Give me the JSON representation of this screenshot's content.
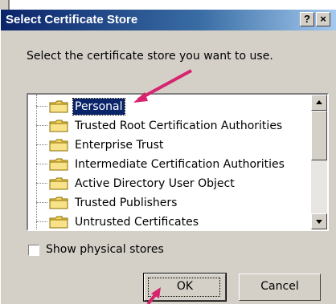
{
  "dialog": {
    "title": "Select Certificate Store",
    "help_glyph": "?",
    "close_glyph": "×",
    "prompt": "Select the certificate store you want to use."
  },
  "tree": {
    "items": [
      {
        "label": "Personal",
        "selected": true
      },
      {
        "label": "Trusted Root Certification Authorities",
        "selected": false
      },
      {
        "label": "Enterprise Trust",
        "selected": false
      },
      {
        "label": "Intermediate Certification Authorities",
        "selected": false
      },
      {
        "label": "Active Directory User Object",
        "selected": false
      },
      {
        "label": "Trusted Publishers",
        "selected": false
      },
      {
        "label": "Untrusted Certificates",
        "selected": false
      }
    ]
  },
  "options": {
    "show_physical_label": "Show physical stores",
    "show_physical_checked": false
  },
  "buttons": {
    "ok": "OK",
    "cancel": "Cancel"
  },
  "colors": {
    "selection": "#0a246a",
    "annotation_arrow": "#d6246e",
    "folder": "#f4d45e"
  },
  "icons": {
    "folder": "folder-icon",
    "scroll_up": "scroll-up-arrow-icon",
    "scroll_down": "scroll-down-arrow-icon"
  }
}
